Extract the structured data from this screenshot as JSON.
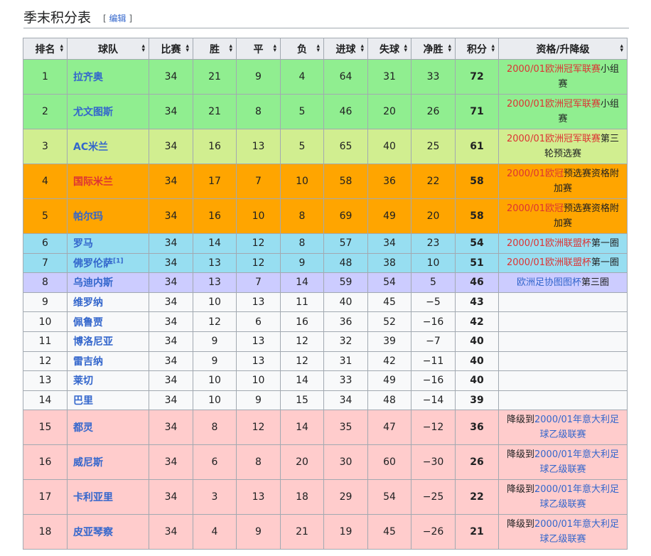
{
  "section": {
    "title": "季末积分表",
    "edit_open": "[",
    "edit_label": "编辑",
    "edit_close": "]"
  },
  "columns": [
    "排名",
    "球队",
    "比赛",
    "胜",
    "平",
    "负",
    "进球",
    "失球",
    "净胜",
    "积分",
    "资格/升降级"
  ],
  "colors": {
    "cl_group": "#90ee90",
    "cl_qual": "#d1ee90",
    "uefa": "#ffa500",
    "uefa_cup": "#97def1",
    "intertoto": "#ccccff",
    "neutral": "#f8f9fa",
    "relegated": "#ffcccc",
    "link_blue": "#3366cc",
    "link_red": "#d33"
  },
  "rows": [
    {
      "rank": "1",
      "team": "拉齐奥",
      "p": "34",
      "w": "21",
      "d": "9",
      "l": "4",
      "gf": "64",
      "ga": "31",
      "gd": "33",
      "pts": "72",
      "zone": "cl_group",
      "note": [
        {
          "t": "2000/01欧洲冠军联赛",
          "c": "red"
        },
        {
          "t": "小组赛",
          "c": ""
        }
      ]
    },
    {
      "rank": "2",
      "team": "尤文图斯",
      "p": "34",
      "w": "21",
      "d": "8",
      "l": "5",
      "gf": "46",
      "ga": "20",
      "gd": "26",
      "pts": "71",
      "zone": "cl_group",
      "note": [
        {
          "t": "2000/01欧洲冠军联赛",
          "c": "red"
        },
        {
          "t": "小组赛",
          "c": ""
        }
      ]
    },
    {
      "rank": "3",
      "team": "AC米兰",
      "p": "34",
      "w": "16",
      "d": "13",
      "l": "5",
      "gf": "65",
      "ga": "40",
      "gd": "25",
      "pts": "61",
      "zone": "cl_qual",
      "note": [
        {
          "t": "2000/01欧洲冠军联赛",
          "c": "red"
        },
        {
          "t": "第三轮预选赛",
          "c": ""
        }
      ]
    },
    {
      "rank": "4",
      "team": "国际米兰",
      "p": "34",
      "w": "17",
      "d": "7",
      "l": "10",
      "gf": "58",
      "ga": "36",
      "gd": "22",
      "pts": "58",
      "zone": "uefa",
      "team_red": true,
      "note": [
        {
          "t": "2000/01欧冠",
          "c": "red"
        },
        {
          "t": "预选赛资格附加赛",
          "c": ""
        }
      ]
    },
    {
      "rank": "5",
      "team": "帕尔玛",
      "p": "34",
      "w": "16",
      "d": "10",
      "l": "8",
      "gf": "69",
      "ga": "49",
      "gd": "20",
      "pts": "58",
      "zone": "uefa",
      "note": [
        {
          "t": "2000/01欧冠",
          "c": "red"
        },
        {
          "t": "预选赛资格附加赛",
          "c": ""
        }
      ]
    },
    {
      "rank": "6",
      "team": "罗马",
      "p": "34",
      "w": "14",
      "d": "12",
      "l": "8",
      "gf": "57",
      "ga": "34",
      "gd": "23",
      "pts": "54",
      "zone": "uefa_cup",
      "note": [
        {
          "t": "2000/01欧洲联盟杯",
          "c": "red"
        },
        {
          "t": "第一圈",
          "c": ""
        }
      ]
    },
    {
      "rank": "7",
      "team": "佛罗伦萨",
      "sup": "[1]",
      "p": "34",
      "w": "13",
      "d": "12",
      "l": "9",
      "gf": "48",
      "ga": "38",
      "gd": "10",
      "pts": "51",
      "zone": "uefa_cup",
      "note": [
        {
          "t": "2000/01欧洲联盟杯",
          "c": "red"
        },
        {
          "t": "第一圈",
          "c": ""
        }
      ]
    },
    {
      "rank": "8",
      "team": "乌迪内斯",
      "p": "34",
      "w": "13",
      "d": "7",
      "l": "14",
      "gf": "59",
      "ga": "54",
      "gd": "5",
      "pts": "46",
      "zone": "intertoto",
      "note": [
        {
          "t": "欧洲足协图图杯",
          "c": "blue"
        },
        {
          "t": "第三圈",
          "c": ""
        }
      ]
    },
    {
      "rank": "9",
      "team": "维罗纳",
      "p": "34",
      "w": "10",
      "d": "13",
      "l": "11",
      "gf": "40",
      "ga": "45",
      "gd": "−5",
      "pts": "43",
      "zone": "neutral",
      "note": []
    },
    {
      "rank": "10",
      "team": "佩鲁贾",
      "p": "34",
      "w": "12",
      "d": "6",
      "l": "16",
      "gf": "36",
      "ga": "52",
      "gd": "−16",
      "pts": "42",
      "zone": "neutral",
      "note": []
    },
    {
      "rank": "11",
      "team": "博洛尼亚",
      "p": "34",
      "w": "9",
      "d": "13",
      "l": "12",
      "gf": "32",
      "ga": "39",
      "gd": "−7",
      "pts": "40",
      "zone": "neutral",
      "note": []
    },
    {
      "rank": "12",
      "team": "雷吉纳",
      "p": "34",
      "w": "9",
      "d": "13",
      "l": "12",
      "gf": "31",
      "ga": "42",
      "gd": "−11",
      "pts": "40",
      "zone": "neutral",
      "note": []
    },
    {
      "rank": "13",
      "team": "莱切",
      "p": "34",
      "w": "10",
      "d": "10",
      "l": "14",
      "gf": "33",
      "ga": "49",
      "gd": "−16",
      "pts": "40",
      "zone": "neutral",
      "note": []
    },
    {
      "rank": "14",
      "team": "巴里",
      "p": "34",
      "w": "10",
      "d": "9",
      "l": "15",
      "gf": "34",
      "ga": "48",
      "gd": "−14",
      "pts": "39",
      "zone": "neutral",
      "note": []
    },
    {
      "rank": "15",
      "team": "都灵",
      "p": "34",
      "w": "8",
      "d": "12",
      "l": "14",
      "gf": "35",
      "ga": "47",
      "gd": "−12",
      "pts": "36",
      "zone": "relegated",
      "note": [
        {
          "t": "降级到",
          "c": ""
        },
        {
          "t": "2000/01年意大利足球乙级联赛",
          "c": "blue"
        }
      ]
    },
    {
      "rank": "16",
      "team": "威尼斯",
      "p": "34",
      "w": "6",
      "d": "8",
      "l": "20",
      "gf": "30",
      "ga": "60",
      "gd": "−30",
      "pts": "26",
      "zone": "relegated",
      "note": [
        {
          "t": "降级到",
          "c": ""
        },
        {
          "t": "2000/01年意大利足球乙级联赛",
          "c": "blue"
        }
      ]
    },
    {
      "rank": "17",
      "team": "卡利亚里",
      "p": "34",
      "w": "3",
      "d": "13",
      "l": "18",
      "gf": "29",
      "ga": "54",
      "gd": "−25",
      "pts": "22",
      "zone": "relegated",
      "note": [
        {
          "t": "降级到",
          "c": ""
        },
        {
          "t": "2000/01年意大利足球乙级联赛",
          "c": "blue"
        }
      ]
    },
    {
      "rank": "18",
      "team": "皮亚琴察",
      "p": "34",
      "w": "4",
      "d": "9",
      "l": "21",
      "gf": "19",
      "ga": "45",
      "gd": "−26",
      "pts": "21",
      "zone": "relegated",
      "note": [
        {
          "t": "降级到",
          "c": ""
        },
        {
          "t": "2000/01年意大利足球乙级联赛",
          "c": "blue"
        }
      ]
    }
  ]
}
